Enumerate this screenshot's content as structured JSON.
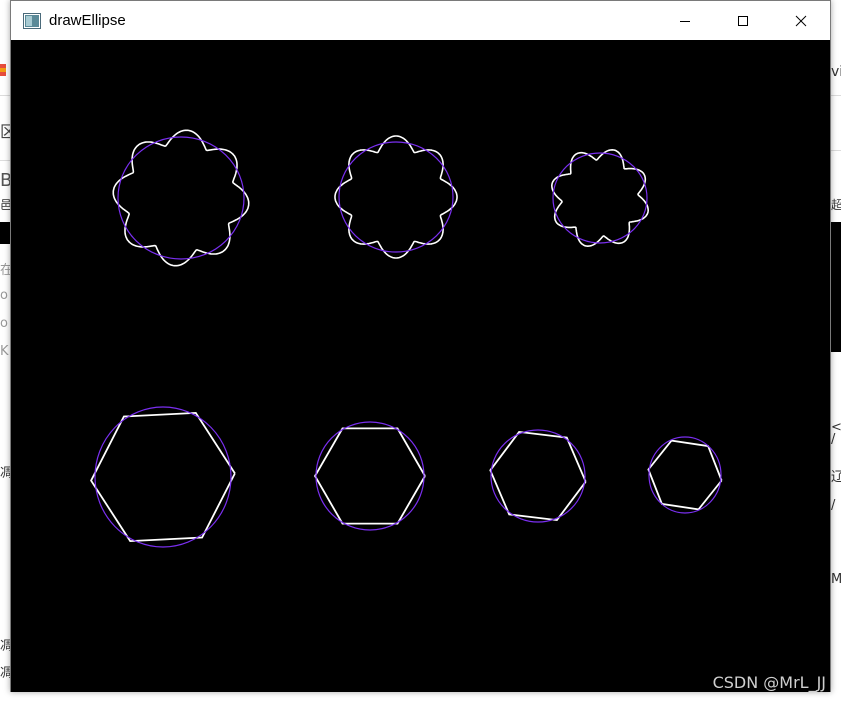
{
  "window": {
    "title": "drawEllipse",
    "icon": "app-window-icon",
    "controls": [
      "minimize-icon",
      "maximize-icon",
      "close-icon"
    ]
  },
  "background_text": [
    "B",
    "邑",
    "超",
    "区",
    "在",
    "o",
    "o",
    "K",
    "凋",
    "<",
    "/",
    "辽",
    "/",
    "M",
    "凋",
    "凋",
    "vic"
  ],
  "watermark": "CSDN @MrL_JJ",
  "colors": {
    "canvas": "#000000",
    "contour": "#ffffff",
    "ellipse_fit": "#7a2ff0"
  },
  "shapes": {
    "gears": [
      {
        "teeth": 8
      },
      {
        "teeth": 8
      },
      {
        "teeth": 8
      }
    ],
    "polygons": [
      {
        "sides": 6
      },
      {
        "sides": 6
      },
      {
        "sides": 6
      },
      {
        "sides": 6
      }
    ]
  }
}
